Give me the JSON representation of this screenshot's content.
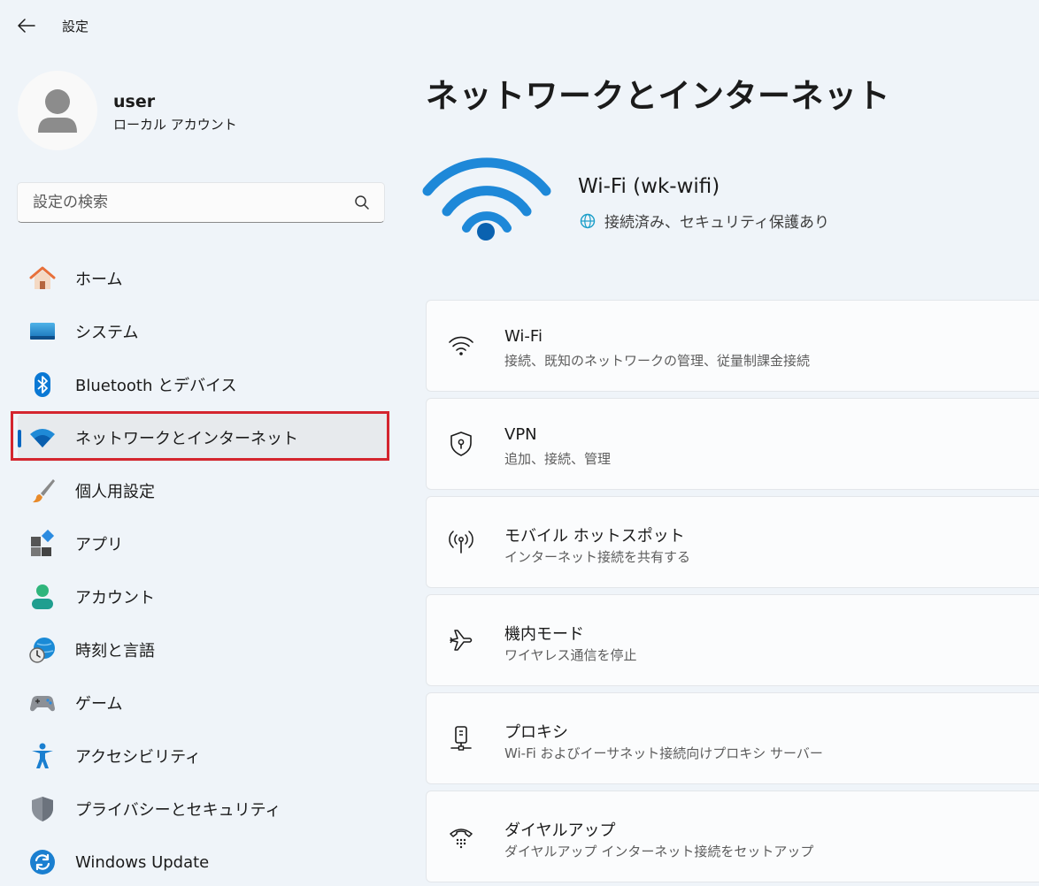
{
  "app": {
    "title": "設定"
  },
  "user": {
    "name": "user",
    "account_type": "ローカル アカウント"
  },
  "search": {
    "placeholder": "設定の検索"
  },
  "nav": {
    "items": [
      {
        "label": "ホーム",
        "icon": "home-icon"
      },
      {
        "label": "システム",
        "icon": "system-icon"
      },
      {
        "label": "Bluetooth とデバイス",
        "icon": "bluetooth-icon"
      },
      {
        "label": "ネットワークとインターネット",
        "icon": "wifi-icon",
        "selected": true
      },
      {
        "label": "個人用設定",
        "icon": "brush-icon"
      },
      {
        "label": "アプリ",
        "icon": "apps-icon"
      },
      {
        "label": "アカウント",
        "icon": "account-icon"
      },
      {
        "label": "時刻と言語",
        "icon": "time-language-icon"
      },
      {
        "label": "ゲーム",
        "icon": "gamepad-icon"
      },
      {
        "label": "アクセシビリティ",
        "icon": "accessibility-icon"
      },
      {
        "label": "プライバシーとセキュリティ",
        "icon": "shield-icon"
      },
      {
        "label": "Windows Update",
        "icon": "update-icon"
      }
    ]
  },
  "main": {
    "title": "ネットワークとインターネット",
    "connection": {
      "name": "Wi-Fi (wk-wifi)",
      "status": "接続済み、セキュリティ保護あり"
    },
    "cards": [
      {
        "title": "Wi-Fi",
        "subtitle": "接続、既知のネットワークの管理、従量制課金接続",
        "icon": "wifi-icon"
      },
      {
        "title": "VPN",
        "subtitle": "追加、接続、管理",
        "icon": "vpn-shield-icon"
      },
      {
        "title": "モバイル ホットスポット",
        "subtitle": "インターネット接続を共有する",
        "icon": "hotspot-icon"
      },
      {
        "title": "機内モード",
        "subtitle": "ワイヤレス通信を停止",
        "icon": "airplane-icon"
      },
      {
        "title": "プロキシ",
        "subtitle": "Wi-Fi およびイーサネット接続向けプロキシ サーバー",
        "icon": "proxy-icon"
      },
      {
        "title": "ダイヤルアップ",
        "subtitle": "ダイヤルアップ インターネット接続をセットアップ",
        "icon": "dialup-icon"
      }
    ]
  },
  "colors": {
    "accent": "#0067c0",
    "highlight": "#d4252e",
    "background": "#eff4f9"
  }
}
